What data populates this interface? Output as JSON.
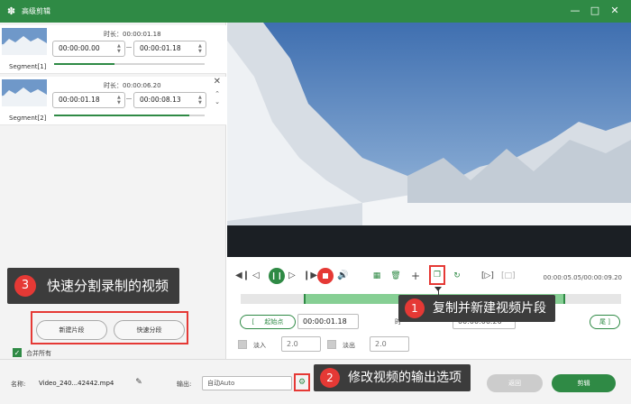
{
  "window": {
    "title": "高级剪辑"
  },
  "segments": [
    {
      "label": "Segment[1]",
      "duration": "时长：00:00:01.18",
      "start": "00:00:00.00",
      "end": "00:00:01.18",
      "progress": 0.4
    },
    {
      "label": "Segment[2]",
      "duration": "时长：00:00:06.20",
      "start": "00:00:01.18",
      "end": "00:00:08.13",
      "progress": 0.9
    }
  ],
  "left": {
    "new_segment": "新建片段",
    "quick_split": "快速分段",
    "merge_all": "合并所有"
  },
  "callouts": {
    "c1": {
      "num": "1",
      "text": "复制并新建视频片段"
    },
    "c2": {
      "num": "2",
      "text": "修改视频的输出选项"
    },
    "c3": {
      "num": "3",
      "text": "快速分割录制的视频"
    }
  },
  "player": {
    "timecode": "00:00:05.05/00:00:09.20",
    "start_btn": "起始点",
    "start_value": "00:00:01.18",
    "time_label": "时",
    "end_value": "00:00:06.20",
    "end_btn": "尾",
    "fade_in": "淡入",
    "fade_in_value": "2.0",
    "fade_out": "淡出",
    "fade_out_value": "2.0"
  },
  "bottom": {
    "name_label": "名称:",
    "file_name": "Video_240...42442.mp4",
    "output_label": "输出:",
    "output_value": "自动Auto",
    "cancel": "返回",
    "clip": "剪辑"
  },
  "colors": {
    "accent": "#2f8a45",
    "callout_num": "#e53935",
    "callout_bg": "#3c3c3c"
  }
}
